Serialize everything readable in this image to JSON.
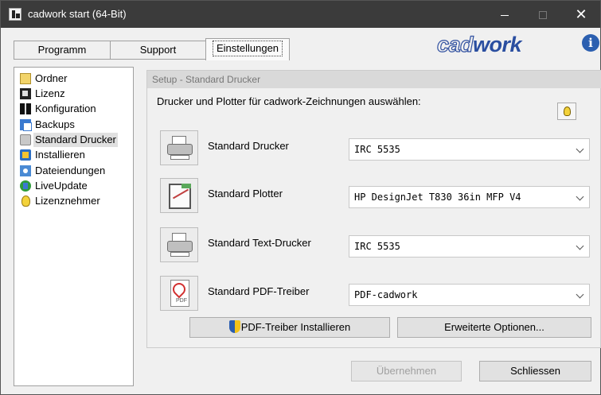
{
  "window": {
    "title": "cadwork start (64-Bit)",
    "close_glyph": "✕"
  },
  "tabs": [
    {
      "label": "Programm"
    },
    {
      "label": "Support"
    },
    {
      "label": "Einstellungen",
      "active": true
    }
  ],
  "logo": {
    "part1": "cad",
    "part2": "work"
  },
  "info_glyph": "i",
  "sidebar": {
    "items": [
      {
        "label": "Ordner",
        "icon": "folder-icon"
      },
      {
        "label": "Lizenz",
        "icon": "license-icon"
      },
      {
        "label": "Konfiguration",
        "icon": "configuration-icon"
      },
      {
        "label": "Backups",
        "icon": "backup-icon"
      },
      {
        "label": "Standard Drucker",
        "icon": "printer-icon",
        "selected": true
      },
      {
        "label": "Installieren",
        "icon": "install-icon"
      },
      {
        "label": "Dateiendungen",
        "icon": "file-extension-icon"
      },
      {
        "label": "LiveUpdate",
        "icon": "liveupdate-icon"
      },
      {
        "label": "Lizenznehmer",
        "icon": "lightbulb-icon"
      }
    ]
  },
  "panel": {
    "header": "Setup - Standard Drucker",
    "description": "Drucker und Plotter für cadwork-Zeichnungen auswählen:",
    "rows": [
      {
        "label": "Standard Drucker",
        "value": "IRC 5535",
        "icon": "printer-icon"
      },
      {
        "label": "Standard Plotter",
        "value": "HP DesignJet T830 36in MFP V4",
        "icon": "plotter-icon"
      },
      {
        "label": "Standard Text-Drucker",
        "value": "IRC 5535",
        "icon": "printer-icon"
      },
      {
        "label": "Standard PDF-Treiber",
        "value": "PDF-cadwork",
        "icon": "pdf-icon",
        "icon_text": "PDF"
      }
    ]
  },
  "buttons": {
    "install_pdf": "PDF-Treiber Installieren",
    "extended_options": "Erweiterte Optionen...",
    "apply": "Übernehmen",
    "close": "Schliessen"
  },
  "colors": {
    "titlebar": "#3b3b3b",
    "brand_blue": "#2a4ea0",
    "selected_item": "#e0e0e0"
  }
}
